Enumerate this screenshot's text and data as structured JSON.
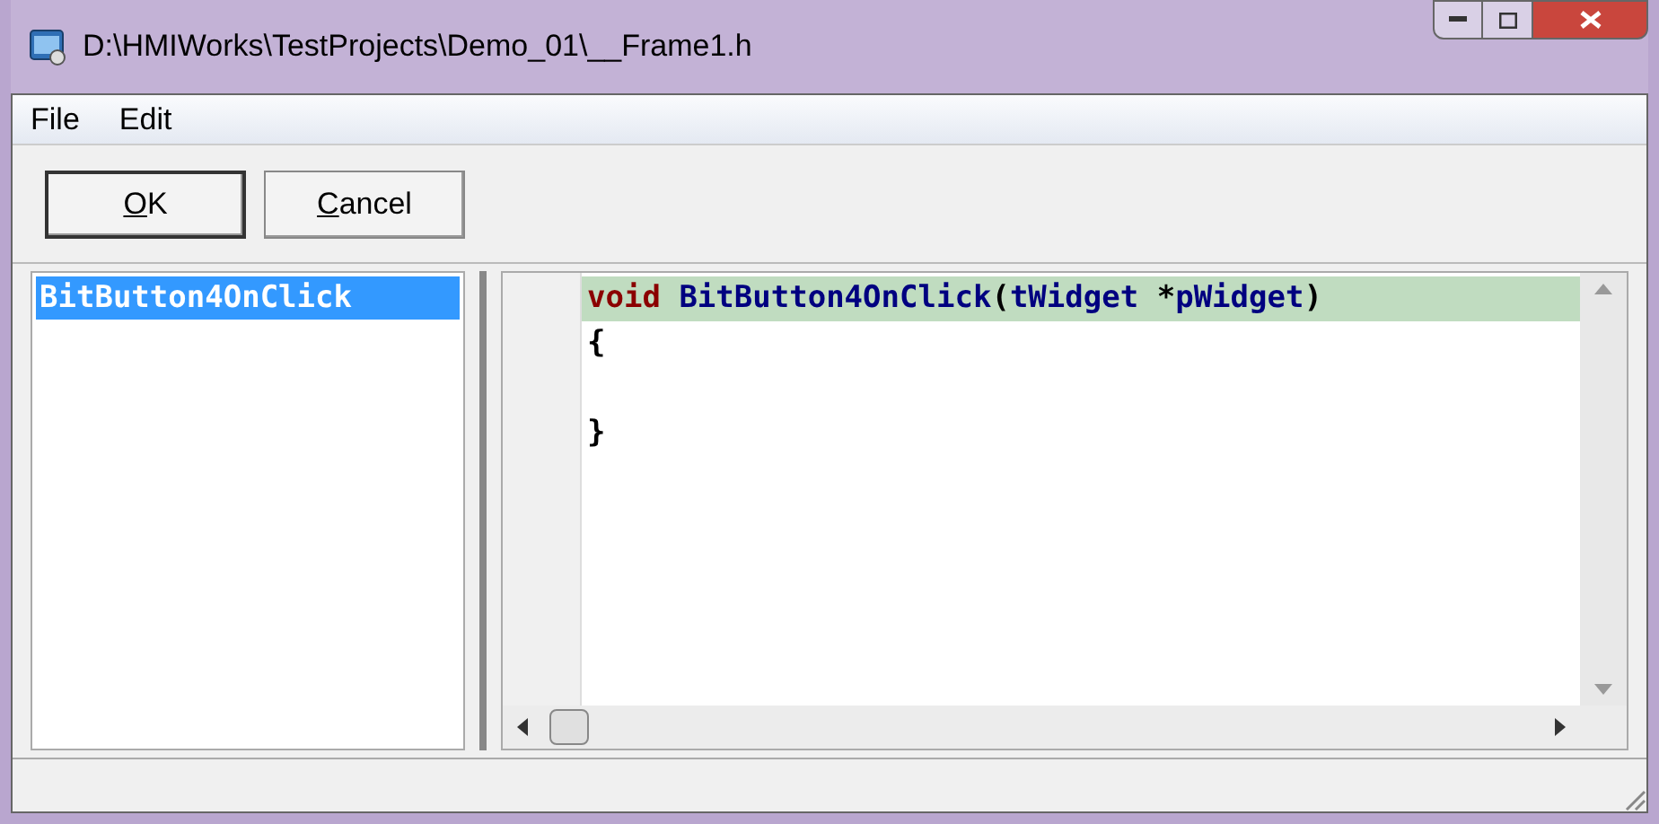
{
  "window": {
    "title": "D:\\HMIWorks\\TestProjects\\Demo_01\\__Frame1.h"
  },
  "menu": [
    "File",
    "Edit"
  ],
  "buttons": [
    {
      "label": "OK",
      "kind": "default"
    },
    {
      "label": "Cancel",
      "kind": "normal"
    }
  ],
  "functions": [
    {
      "label": "BitButton4OnClick",
      "selected": true
    }
  ],
  "editor": {
    "lines": [
      {
        "highlighted": true,
        "tokens": [
          {
            "text": "void ",
            "kind": "keyword"
          },
          {
            "text": "BitButton4OnClick",
            "kind": "identifier"
          },
          {
            "text": "(",
            "kind": "punct"
          },
          {
            "text": "tWidget ",
            "kind": "identifier"
          },
          {
            "text": "*",
            "kind": "punct"
          },
          {
            "text": "pWidget",
            "kind": "identifier"
          },
          {
            "text": ")",
            "kind": "punct"
          }
        ]
      },
      {
        "highlighted": false,
        "tokens": [
          {
            "text": "{",
            "kind": "punct"
          }
        ]
      },
      {
        "highlighted": false
      },
      {
        "highlighted": false,
        "tokens": [
          {
            "text": "}",
            "kind": "punct"
          }
        ]
      }
    ]
  }
}
